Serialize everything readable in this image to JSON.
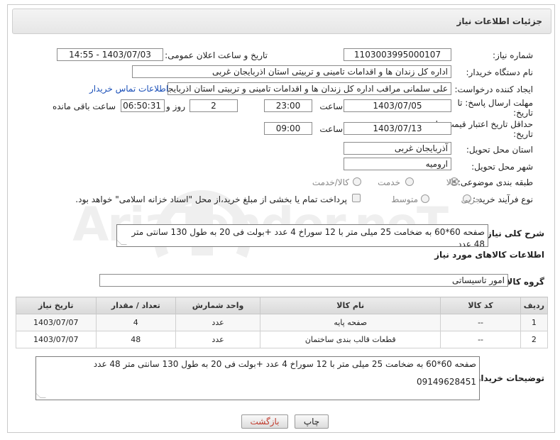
{
  "panel_title": "جزئیات اطلاعات نیاز",
  "fields": {
    "need_number_label": "شماره نیاز:",
    "need_number": "1103003995000107",
    "announce_label": "تاریخ و ساعت اعلان عمومی:",
    "announce_value": "1403/07/03 - 14:55",
    "buyer_org_label": "نام دستگاه خریدار:",
    "buyer_org": "اداره کل زندان ها و اقدامات تامینی و تربیتی استان اذربایجان غربی",
    "creator_label": "ایجاد کننده درخواست:",
    "creator": "علی سلمانی مراقب اداره کل زندان ها و اقدامات تامینی و تربیتی استان اذربایجان",
    "contact_link": "اطلاعات تماس خریدار",
    "deadline_label_1": "مهلت ارسال پاسخ: تا",
    "deadline_label_2": "تاریخ:",
    "deadline_date": "1403/07/05",
    "time_label": "ساعت",
    "deadline_time": "23:00",
    "days_value": "2",
    "days_label": "روز و",
    "remaining_time": "06:50:31",
    "remaining_label": "ساعت باقی مانده",
    "validity_label_1": "حداقل تاریخ اعتبار قیمت: تا",
    "validity_label_2": "تاریخ:",
    "validity_date": "1403/07/13",
    "validity_time": "09:00",
    "province_label": "استان محل تحویل:",
    "province": "آذربایجان غربی",
    "city_label": "شهر محل تحویل:",
    "city": "ارومیه",
    "category_label": "طبقه بندی موضوعی:",
    "category_options": [
      "کالا",
      "خدمت",
      "کالا/خدمت"
    ],
    "purchase_label": "نوع فرآیند خرید :",
    "purchase_options": [
      "جزیی",
      "متوسط"
    ],
    "payment_note": "پرداخت تمام یا بخشی از مبلغ خرید،از محل \"اسناد خزانه اسلامی\" خواهد بود.",
    "summary_label": "شرح کلی نیاز:",
    "summary": "صفحه 60*60 به ضخامت 25 میلی متر با 12 سوراخ   4 عدد      +بولت  فی 20 به طول 130 سانتی متر 48 عدد"
  },
  "goods_section_title": "اطلاعات کالاهای مورد نیاز",
  "goods_group_label": "گروه کالا:",
  "goods_group": "امور تاسیساتی",
  "table": {
    "headers": [
      "ردیف",
      "کد کالا",
      "نام کالا",
      "واحد شمارش",
      "تعداد / مقدار",
      "تاریخ نیاز"
    ],
    "rows": [
      [
        "1",
        "--",
        "صفحه پایه",
        "عدد",
        "4",
        "1403/07/07"
      ],
      [
        "2",
        "--",
        "قطعات قالب بندی ساختمان",
        "عدد",
        "48",
        "1403/07/07"
      ]
    ]
  },
  "buyer_notes_label": "توضیحات خریدار:",
  "buyer_notes_line1": "صفحه 60*60 به ضخامت 25 میلی متر با 12 سوراخ   4 عدد      +بولت  فی 20 به طول 130 سانتی متر 48 عدد",
  "buyer_notes_line2": "09149628451",
  "buttons": {
    "print": "چاپ",
    "back": "بازگشت"
  },
  "watermark_text": "AriaTender.neT",
  "colors": {
    "link": "#1a4fb8",
    "back_button_text": "#c0392b"
  }
}
